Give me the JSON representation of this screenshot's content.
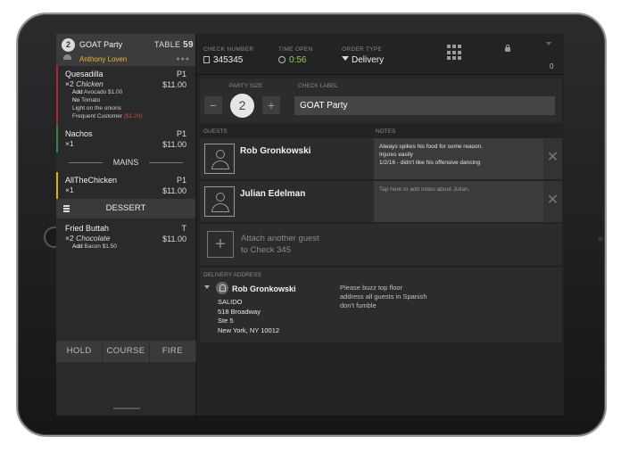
{
  "check": {
    "party_size": "2",
    "party_name": "GOAT Party",
    "table_label": "TABLE",
    "table_number": "59",
    "server": "Anthony Loven"
  },
  "order_items": [
    {
      "name": "Quesadilla",
      "seat": "P1",
      "qty": "×2",
      "qty_note": "Chicken",
      "price": "$11.00",
      "modifiers": [
        {
          "label": "Add",
          "value": "Avocado  $1.00"
        },
        {
          "label": "No",
          "value": "Tomato"
        },
        {
          "label": "",
          "value": "Light on the onions"
        },
        {
          "label": "",
          "value": "Frequent Customer",
          "extra": "($1.20)"
        }
      ]
    },
    {
      "name": "Nachos",
      "seat": "P1",
      "qty": "×1",
      "price": "$11.00"
    },
    {
      "name": "AllTheChicken",
      "seat": "P1",
      "qty": "×1",
      "price": "$11.00"
    },
    {
      "name": "Fried Buttah",
      "seat": "T",
      "qty": "×2",
      "qty_note": "Chocolate",
      "price": "$11.00",
      "modifiers": [
        {
          "label": "Add",
          "value": "Bacon  $1.50"
        }
      ]
    }
  ],
  "courses": {
    "mains": "MAINS",
    "dessert": "DESSERT"
  },
  "actions": {
    "hold": "HOLD",
    "course": "COURSE",
    "fire": "FIRE"
  },
  "topbar": {
    "check_number_label": "CHECK NUMBER",
    "check_number": "345345",
    "time_open_label": "TIME OPEN",
    "time_open": "0:56",
    "order_type_label": "ORDER TYPE",
    "order_type": "Delivery",
    "count": "0"
  },
  "party_section": {
    "party_size_label": "PARTY SIZE",
    "check_label_label": "CHECK LABEL",
    "minus": "−",
    "plus": "+",
    "check_label_value": "GOAT Party"
  },
  "guests_section": {
    "guests_label": "GUESTS",
    "notes_label": "NOTES",
    "guests": [
      {
        "name": "Rob Gronkowski",
        "notes": [
          "Always spikes his food for some reason.",
          "Injures easily",
          "1/2/16 - didn't like his offensive dancing"
        ]
      },
      {
        "name": "Julian Edelman",
        "notes_placeholder": "Tap here to add notes about Julian."
      }
    ],
    "attach_text_1": "Attach another guest",
    "attach_text_2": "to Check 345"
  },
  "delivery": {
    "label": "DELIVERY ADDRESS",
    "name": "Rob Gronkowski",
    "address": [
      "SALIDO",
      "518 Broadway",
      "Ste 5",
      "New York, NY 10012"
    ],
    "notes": [
      "Please buzz top floor",
      "address all guests in Spanish",
      "don't fumble"
    ]
  },
  "colors": {
    "server_text": "#e6b92a",
    "time_open_text": "#8fd24a",
    "bar_red": "#b0282e",
    "bar_green": "#2e8b3b",
    "bar_yellow": "#d6b21e",
    "discount_text": "#d9434b"
  },
  "icons": [
    "user-icon",
    "grid-icon",
    "lock-icon",
    "clock-icon",
    "receipt-icon",
    "hamburger-icon",
    "close-icon",
    "plus-icon",
    "avatar-icon"
  ]
}
